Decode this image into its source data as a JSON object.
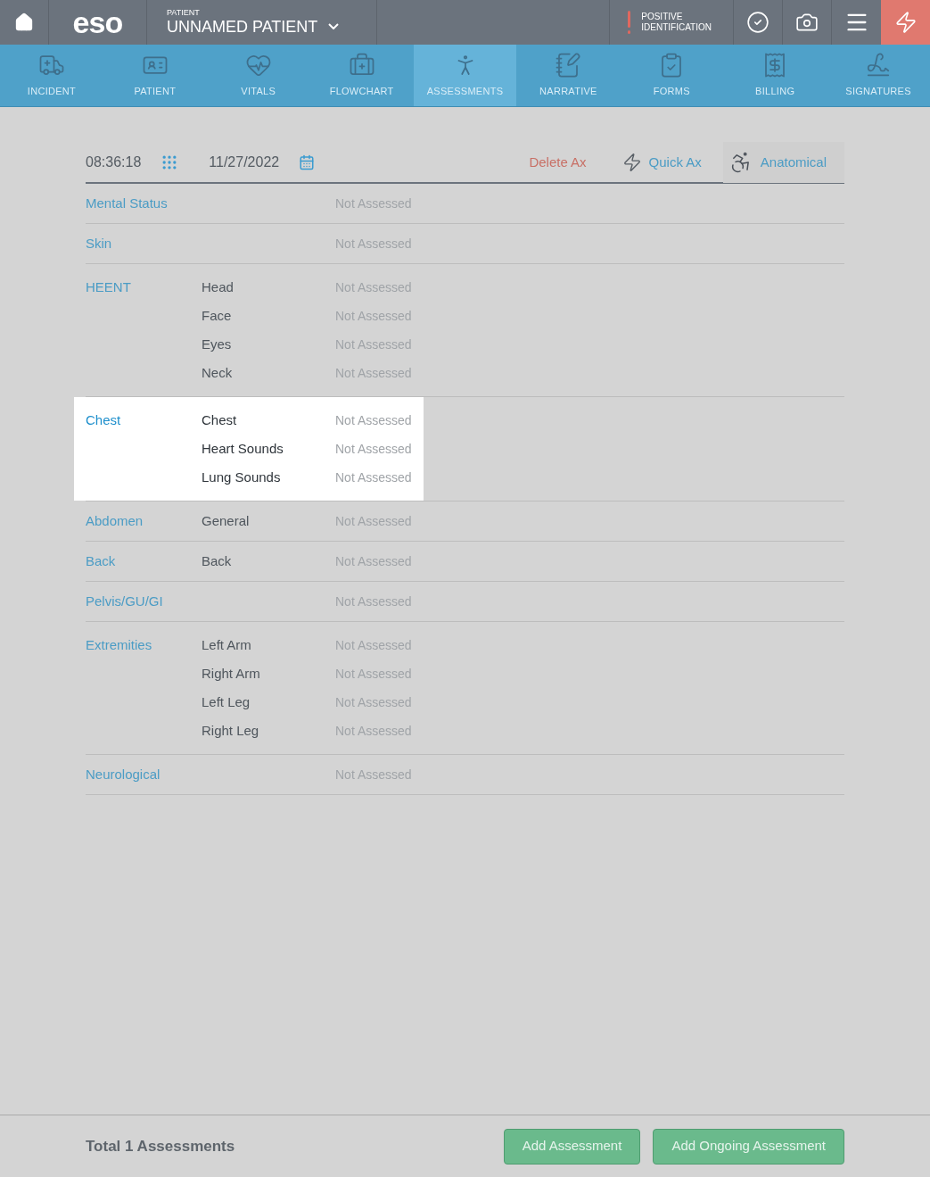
{
  "header": {
    "patient_label": "PATIENT",
    "patient_name": "UNNAMED PATIENT",
    "alert": "POSITIVE IDENTIFICATION",
    "logo": "eso"
  },
  "nav_tabs": [
    {
      "label": "INCIDENT",
      "selected": false
    },
    {
      "label": "PATIENT",
      "selected": false
    },
    {
      "label": "VITALS",
      "selected": false
    },
    {
      "label": "FLOWCHART",
      "selected": false
    },
    {
      "label": "ASSESSMENTS",
      "selected": true
    },
    {
      "label": "NARRATIVE",
      "selected": false
    },
    {
      "label": "FORMS",
      "selected": false
    },
    {
      "label": "BILLING",
      "selected": false
    },
    {
      "label": "SIGNATURES",
      "selected": false
    }
  ],
  "toolbar": {
    "time": "08:36:18",
    "date": "11/27/2022",
    "delete": "Delete Ax",
    "quick": "Quick Ax",
    "anatomical": "Anatomical"
  },
  "sections": [
    {
      "name": "Mental Status",
      "selected": false,
      "items": [
        {
          "status": "Not Assessed"
        }
      ]
    },
    {
      "name": "Skin",
      "selected": false,
      "items": [
        {
          "status": "Not Assessed"
        }
      ]
    },
    {
      "name": "HEENT",
      "selected": false,
      "items": [
        {
          "label": "Head",
          "status": "Not Assessed"
        },
        {
          "label": "Face",
          "status": "Not Assessed"
        },
        {
          "label": "Eyes",
          "status": "Not Assessed"
        },
        {
          "label": "Neck",
          "status": "Not Assessed"
        }
      ]
    },
    {
      "name": "Chest",
      "selected": true,
      "items": [
        {
          "label": "Chest",
          "status": "Not Assessed"
        },
        {
          "label": "Heart Sounds",
          "status": "Not Assessed"
        },
        {
          "label": "Lung Sounds",
          "status": "Not Assessed"
        }
      ]
    },
    {
      "name": "Abdomen",
      "selected": false,
      "items": [
        {
          "label": "General",
          "status": "Not Assessed"
        }
      ]
    },
    {
      "name": "Back",
      "selected": false,
      "items": [
        {
          "label": "Back",
          "status": "Not Assessed"
        }
      ]
    },
    {
      "name": "Pelvis/GU/GI",
      "selected": false,
      "items": [
        {
          "status": "Not Assessed"
        }
      ]
    },
    {
      "name": "Extremities",
      "selected": false,
      "items": [
        {
          "label": "Left Arm",
          "status": "Not Assessed"
        },
        {
          "label": "Right Arm",
          "status": "Not Assessed"
        },
        {
          "label": "Left Leg",
          "status": "Not Assessed"
        },
        {
          "label": "Right Leg",
          "status": "Not Assessed"
        }
      ]
    },
    {
      "name": "Neurological",
      "selected": false,
      "items": [
        {
          "status": "Not Assessed"
        }
      ]
    }
  ],
  "footer": {
    "total": "Total 1 Assessments",
    "buttons": [
      "Add Assessment",
      "Add Ongoing Assessment"
    ]
  }
}
